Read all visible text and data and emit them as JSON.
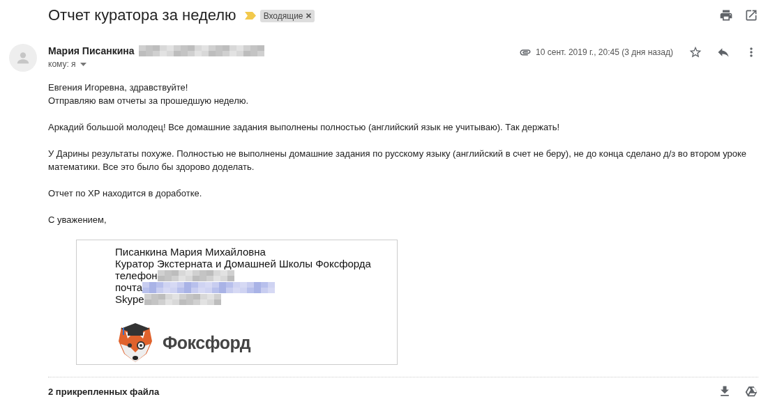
{
  "subject": "Отчет куратора за неделю",
  "important": true,
  "labels": [
    {
      "text": "Входящие"
    }
  ],
  "sender": {
    "name": "Мария Писанкина",
    "to": "кому: я",
    "date": "10 сент. 2019 г., 20:45 (3 дня назад)",
    "has_attachment": true,
    "starred": false
  },
  "body": {
    "paragraphs": [
      [
        "Евгения Игоревна, здравствуйте!",
        "Отправляю вам отчеты за прошедшую неделю."
      ],
      [
        "Аркадий большой молодец! Все домашние задания выполнены полностью (английский язык не учитываю). Так держать!"
      ],
      [
        "У Дарины результаты похуже. Полностью не выполнены домашние задания по русскому языку (английский в счет не беру), не до конца сделано д/з во втором уроке математики. Все это было бы здорово доделать."
      ],
      [
        "Отчет по ХР находится в доработке."
      ],
      [
        "С уважением,"
      ]
    ]
  },
  "signature": {
    "lines": [
      {
        "kind": "plain",
        "text": "Писанкина Мария Михайловна"
      },
      {
        "kind": "plain",
        "text": "Куратор Экстерната и Домашней Школы Фоксфорда"
      },
      {
        "kind": "redacted",
        "text": "телефон"
      },
      {
        "kind": "redacted-link",
        "text": "почта"
      },
      {
        "kind": "redacted",
        "text": "Skype"
      }
    ],
    "logo_text": "Фоксфорд"
  },
  "attachments": {
    "title": "2 прикрепленных файла"
  }
}
